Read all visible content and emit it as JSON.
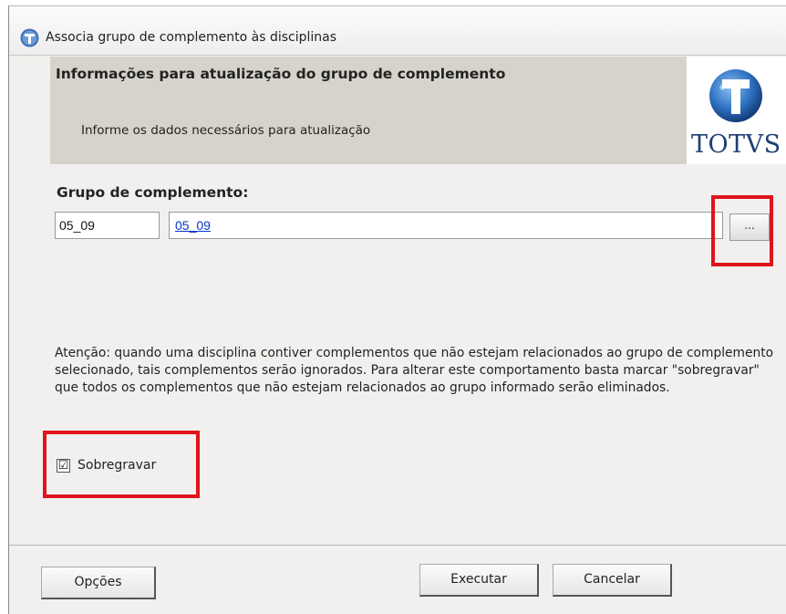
{
  "window": {
    "title": "Associa grupo de complemento às disciplinas"
  },
  "header": {
    "title": "Informações para atualização do grupo de complemento",
    "subtitle": "Informe os dados necessários para atualização",
    "logo_text": "TOTVS"
  },
  "form": {
    "group_label": "Grupo de complemento:",
    "group_code": "05_09",
    "group_description": "05_09",
    "lookup_label": "..."
  },
  "warning": "Atenção: quando uma disciplina contiver complementos que não estejam relacionados ao grupo de complemento selecionado, tais complementos serão ignorados. Para alterar este comportamento basta marcar \"sobregravar\" que todos os complementos que não estejam relacionados ao grupo informado serão eliminados.",
  "overwrite": {
    "label": "Sobregravar",
    "checked": true,
    "mark": "☑"
  },
  "buttons": {
    "options": "Opções",
    "execute": "Executar",
    "cancel": "Cancelar"
  },
  "colors": {
    "highlight": "#e0141b",
    "header_bg": "#d6d3cb",
    "link": "#0a33cc",
    "brand": "#1d3f73"
  }
}
